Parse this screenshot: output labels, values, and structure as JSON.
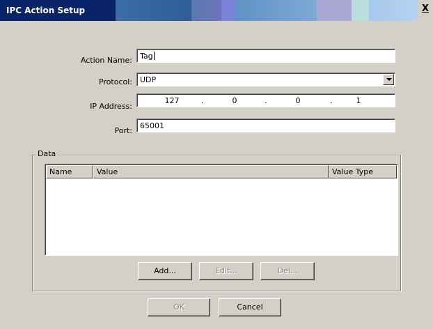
{
  "window": {
    "title": "IPC Action Setup",
    "close_glyph": "X"
  },
  "form": {
    "action_name_label": "Action Name:",
    "action_name_value": "Tag",
    "protocol_label": "Protocol:",
    "protocol_value": "UDP",
    "ip_label": "IP Address:",
    "ip_octets": [
      "127",
      "0",
      "0",
      "1"
    ],
    "ip_separator": ".",
    "port_label": "Port:",
    "port_value": "65001"
  },
  "data_group": {
    "label": "Data",
    "columns": [
      "Name",
      "Value",
      "Value Type"
    ],
    "rows": []
  },
  "buttons": {
    "add": "Add...",
    "edit": "Edit...",
    "del": "Del...",
    "ok": "OK",
    "cancel": "Cancel"
  },
  "icons": {
    "dropdown": "chevron-down-icon",
    "close": "close-icon"
  }
}
